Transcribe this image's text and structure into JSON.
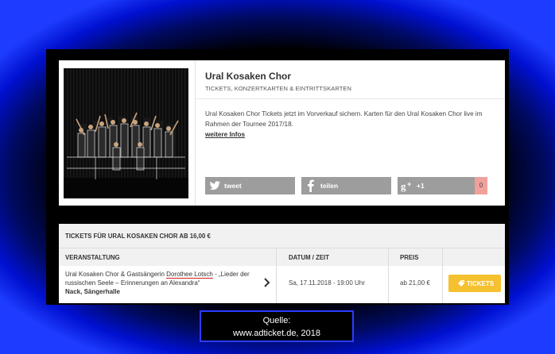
{
  "artist": {
    "title": "Ural Kosaken Chor",
    "subtitle": "TICKETS, KONZERTKARTEN & EINTRITTSKARTEN",
    "description": "Ural Kosaken Chor Tickets jetzt im Vorverkauf sichern. Karten für den Ural Kosaken Chor live im Rahmen der Tournee 2017/18.",
    "more_link": "weitere Infos"
  },
  "share": {
    "tweet": "tweet",
    "teilen": "teilen",
    "plus": "+1",
    "plus_count": "0"
  },
  "tickets": {
    "heading": "TICKETS FÜR URAL KOSAKEN CHOR AB 16,00 €",
    "columns": [
      "VERANSTALTUNG",
      "DATUM / ZEIT",
      "PREIS"
    ],
    "row": {
      "event_prefix": "Ural Kosaken Chor & Gastsängerin ",
      "event_artist": "Dorothee Lotsch",
      "event_suffix": " - „Lieder der russischen Seele – Erinnerungen an Alexandra“",
      "venue": "Nack, Sängerhalle",
      "date": "Sa, 17.11.2018 - 19:00 Uhr",
      "price": "ab 21,00 €",
      "button": "TICKETS"
    }
  },
  "source": {
    "label": "Quelle:",
    "url": "www.adticket.de, 2018"
  },
  "colors": {
    "share_gray": "#9d9d9d",
    "tickets_yellow": "#f5c12e",
    "frame_blue": "#1e3cff",
    "underline_red": "#d21f1f"
  }
}
